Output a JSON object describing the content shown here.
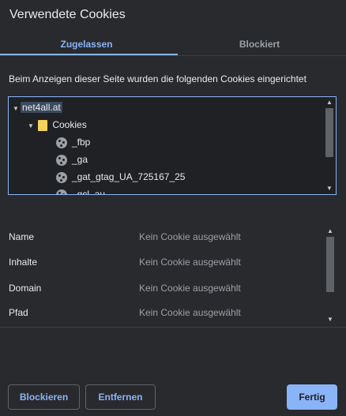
{
  "dialog": {
    "title": "Verwendete Cookies"
  },
  "tabs": [
    {
      "label": "Zugelassen",
      "active": true
    },
    {
      "label": "Blockiert",
      "active": false
    }
  ],
  "description": "Beim Anzeigen dieser Seite wurden die folgenden Cookies eingerichtet",
  "tree": {
    "root": {
      "label": "net4all.at",
      "expanded": true,
      "selected": true
    },
    "folder": {
      "label": "Cookies",
      "expanded": true
    },
    "cookies": [
      "_fbp",
      "_ga",
      "_gat_gtag_UA_725167_25",
      "_gcl_au"
    ]
  },
  "details": [
    {
      "label": "Name",
      "value": "Kein Cookie ausgewählt"
    },
    {
      "label": "Inhalte",
      "value": "Kein Cookie ausgewählt"
    },
    {
      "label": "Domain",
      "value": "Kein Cookie ausgewählt"
    },
    {
      "label": "Pfad",
      "value": "Kein Cookie ausgewählt"
    }
  ],
  "buttons": {
    "block": "Blockieren",
    "remove": "Entfernen",
    "done": "Fertig"
  },
  "colors": {
    "accent": "#8ab4f8",
    "background": "#292a2d",
    "folder": "#f3d35c"
  },
  "icons": {
    "folder": "folder-icon",
    "cookie": "cookie-icon",
    "expand": "triangle-down-icon"
  }
}
